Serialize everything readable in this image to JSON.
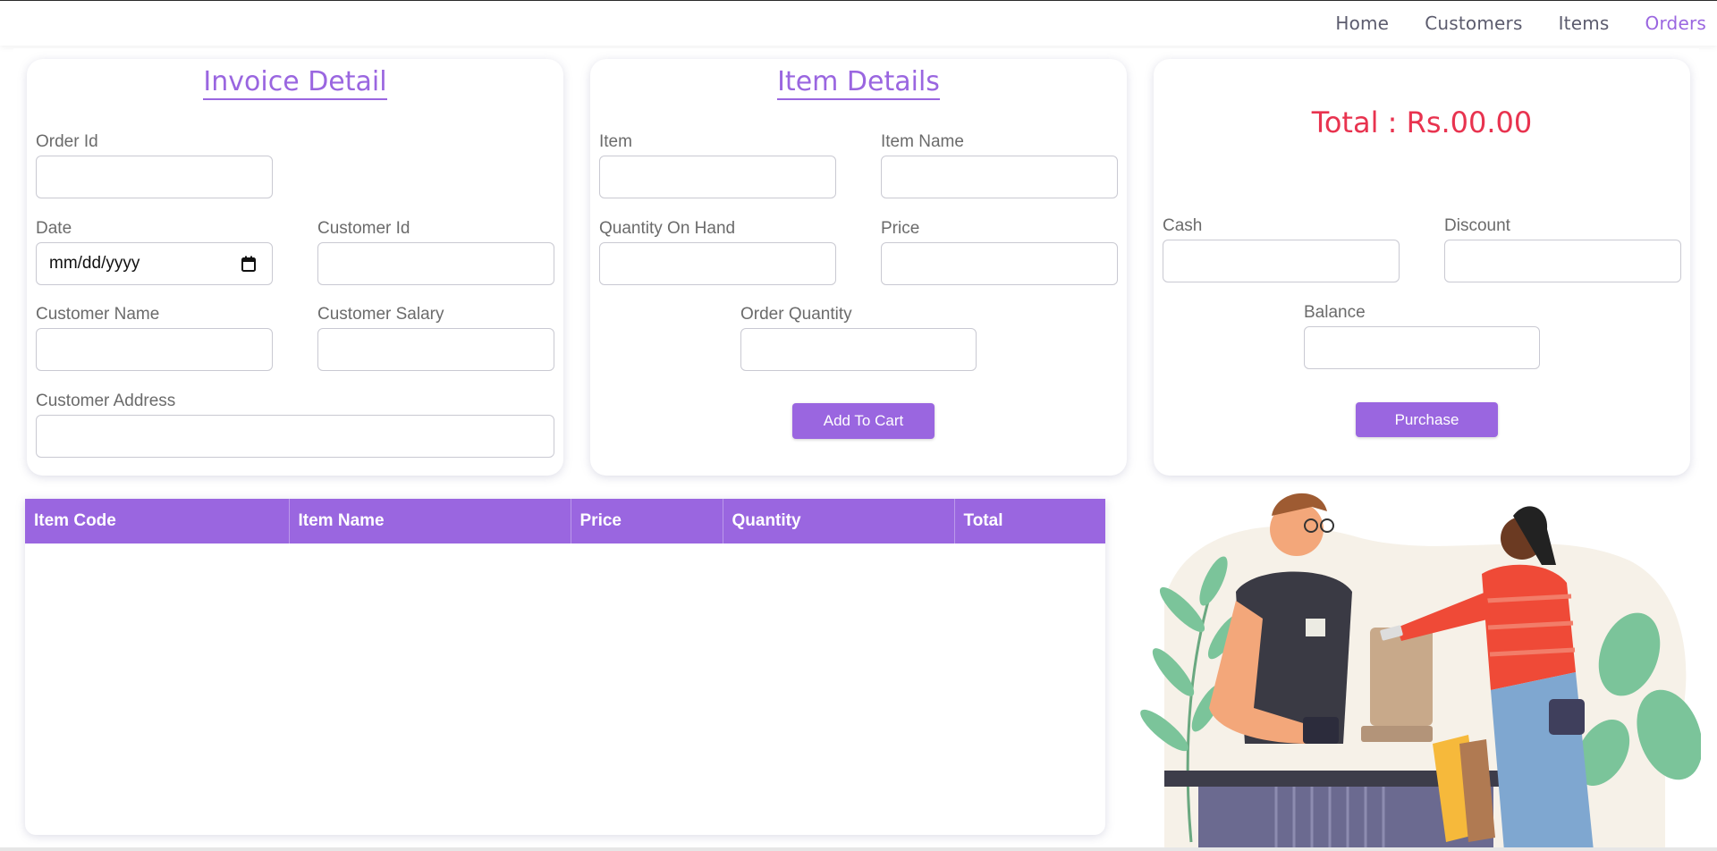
{
  "nav": {
    "items": [
      {
        "label": "Home"
      },
      {
        "label": "Customers"
      },
      {
        "label": "Items"
      },
      {
        "label": "Orders"
      }
    ]
  },
  "invoice": {
    "title": "Invoice Detail",
    "order_id_label": "Order Id",
    "date_label": "Date",
    "date_value": "mm/dd/yyyy",
    "customer_id_label": "Customer Id",
    "customer_name_label": "Customer Name",
    "customer_salary_label": "Customer Salary",
    "customer_address_label": "Customer Address"
  },
  "item_details": {
    "title": "Item Details",
    "item_label": "Item",
    "item_name_label": "Item Name",
    "qty_on_hand_label": "Quantity On Hand",
    "price_label": "Price",
    "order_qty_label": "Order Quantity",
    "add_button": "Add To Cart"
  },
  "payment": {
    "total_text": "Total : Rs.00.00",
    "cash_label": "Cash",
    "discount_label": "Discount",
    "balance_label": "Balance",
    "purchase_button": "Purchase"
  },
  "cart_table": {
    "columns": [
      "Item Code",
      "Item Name",
      "Price",
      "Quantity",
      "Total"
    ],
    "rows": []
  },
  "colors": {
    "accent": "#9a66e0",
    "total_red": "#e8334f"
  },
  "illustration": {
    "icon": "cashier-customer-illustration"
  }
}
